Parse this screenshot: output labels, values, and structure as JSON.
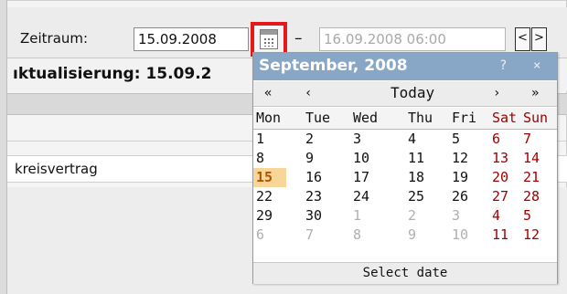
{
  "toolbar": {
    "zeitraum_label": "Zeitraum:",
    "from_value": "15.09.2008",
    "to_value": "16.09.2008 06:00",
    "dash": "–",
    "prev_label": "<",
    "next_label": ">",
    "calendar_icon": "calendar-icon",
    "highlight_color": "#e3191c"
  },
  "update_line": {
    "text": "ıktualisierung: 15.09.2"
  },
  "table": {
    "row_text": "kreisvertrag"
  },
  "calendar": {
    "title": "September, 2008",
    "help": "?",
    "close": "×",
    "nav": {
      "prev_year": "«",
      "prev_month": "‹",
      "today": "Today",
      "next_month": "›",
      "next_year": "»"
    },
    "day_names": [
      "Mon",
      "Tue",
      "Wed",
      "Thu",
      "Fri",
      "Sat",
      "Sun"
    ],
    "weeks": [
      [
        "1",
        "2",
        "3",
        "4",
        "5",
        "6",
        "7"
      ],
      [
        "8",
        "9",
        "10",
        "11",
        "12",
        "13",
        "14"
      ],
      [
        "15",
        "16",
        "17",
        "18",
        "19",
        "20",
        "21"
      ],
      [
        "22",
        "23",
        "24",
        "25",
        "26",
        "27",
        "28"
      ],
      [
        "29",
        "30",
        "1",
        "2",
        "3",
        "4",
        "5"
      ],
      [
        "6",
        "7",
        "8",
        "9",
        "10",
        "11",
        "12"
      ]
    ],
    "footer": "Select date",
    "header_color": "#88a6c5",
    "weekend_color": "#a00000",
    "today_bg": "#f8d69a"
  }
}
